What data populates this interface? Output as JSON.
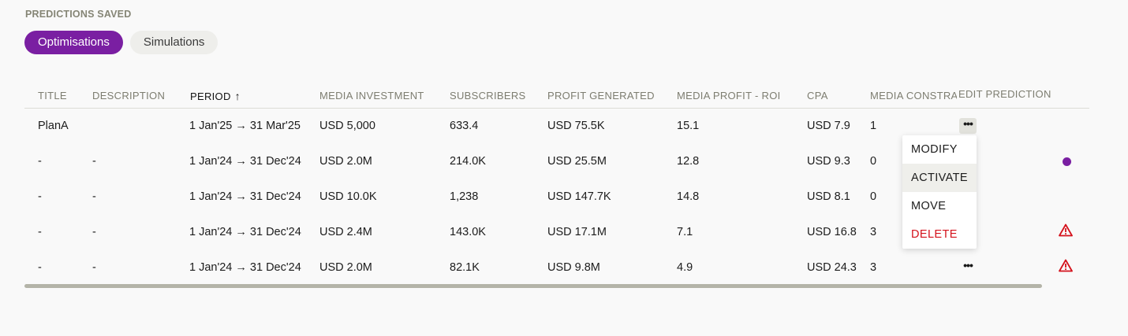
{
  "section_title": "PREDICTIONS SAVED",
  "tabs": [
    {
      "label": "Optimisations",
      "active": true
    },
    {
      "label": "Simulations",
      "active": false
    }
  ],
  "columns": {
    "title": "TITLE",
    "description": "DESCRIPTION",
    "period": "PERIOD",
    "period_sort_icon": "arrow-up-icon",
    "media_investment": "MEDIA INVESTMENT",
    "subscribers": "SUBSCRIBERS",
    "profit_generated": "PROFIT GENERATED",
    "media_profit_roi": "MEDIA PROFIT - ROI",
    "cpa": "CPA",
    "media_constraints": "MEDIA CONSTRA",
    "edit_prediction": "EDIT PREDICTION"
  },
  "rows": [
    {
      "title": "PlanA",
      "description": "",
      "period": "1 Jan'25 → 31 Mar'25",
      "media_investment": "USD 5,000",
      "subscribers": "633.4",
      "profit_generated": "USD 75.5K",
      "roi": "15.1",
      "cpa": "USD 7.9",
      "constraints": "1",
      "actions": "•••",
      "status": "none"
    },
    {
      "title": "-",
      "description": "-",
      "period": "1 Jan'24 → 31 Dec'24",
      "media_investment": "USD 2.0M",
      "subscribers": "214.0K",
      "profit_generated": "USD 25.5M",
      "roi": "12.8",
      "cpa": "USD 9.3",
      "constraints": "0",
      "actions": "",
      "status": "active-dot"
    },
    {
      "title": "-",
      "description": "-",
      "period": "1 Jan'24 → 31 Dec'24",
      "media_investment": "USD 10.0K",
      "subscribers": "1,238",
      "profit_generated": "USD 147.7K",
      "roi": "14.8",
      "cpa": "USD 8.1",
      "constraints": "0",
      "actions": "",
      "status": "none"
    },
    {
      "title": "-",
      "description": "-",
      "period": "1 Jan'24 → 31 Dec'24",
      "media_investment": "USD 2.4M",
      "subscribers": "143.0K",
      "profit_generated": "USD 17.1M",
      "roi": "7.1",
      "cpa": "USD 16.8",
      "constraints": "3",
      "actions": "",
      "status": "warning-icon"
    },
    {
      "title": "-",
      "description": "-",
      "period": "1 Jan'24 → 31 Dec'24",
      "media_investment": "USD 2.0M",
      "subscribers": "82.1K",
      "profit_generated": "USD 9.8M",
      "roi": "4.9",
      "cpa": "USD 24.3",
      "constraints": "3",
      "actions": "•••",
      "status": "warning-icon"
    }
  ],
  "menu": {
    "items": [
      "MODIFY",
      "ACTIVATE",
      "MOVE",
      "DELETE"
    ],
    "hovered": "ACTIVATE",
    "danger": "DELETE"
  },
  "colors": {
    "accent": "#7a1fa2",
    "warning": "#d4111b",
    "muted_header": "#7d7d70"
  }
}
